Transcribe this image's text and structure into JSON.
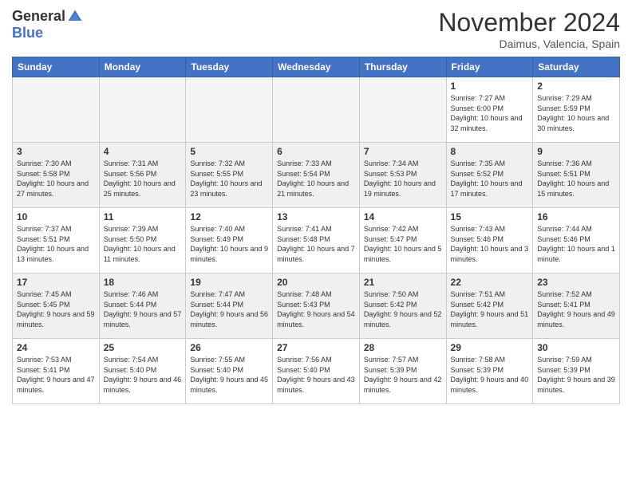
{
  "header": {
    "logo_general": "General",
    "logo_blue": "Blue",
    "month_title": "November 2024",
    "subtitle": "Daimus, Valencia, Spain"
  },
  "days_of_week": [
    "Sunday",
    "Monday",
    "Tuesday",
    "Wednesday",
    "Thursday",
    "Friday",
    "Saturday"
  ],
  "weeks": [
    [
      {
        "day": "",
        "info": "",
        "empty": true
      },
      {
        "day": "",
        "info": "",
        "empty": true
      },
      {
        "day": "",
        "info": "",
        "empty": true
      },
      {
        "day": "",
        "info": "",
        "empty": true
      },
      {
        "day": "",
        "info": "",
        "empty": true
      },
      {
        "day": "1",
        "info": "Sunrise: 7:27 AM\nSunset: 6:00 PM\nDaylight: 10 hours and 32 minutes."
      },
      {
        "day": "2",
        "info": "Sunrise: 7:29 AM\nSunset: 5:59 PM\nDaylight: 10 hours and 30 minutes."
      }
    ],
    [
      {
        "day": "3",
        "info": "Sunrise: 7:30 AM\nSunset: 5:58 PM\nDaylight: 10 hours and 27 minutes."
      },
      {
        "day": "4",
        "info": "Sunrise: 7:31 AM\nSunset: 5:56 PM\nDaylight: 10 hours and 25 minutes."
      },
      {
        "day": "5",
        "info": "Sunrise: 7:32 AM\nSunset: 5:55 PM\nDaylight: 10 hours and 23 minutes."
      },
      {
        "day": "6",
        "info": "Sunrise: 7:33 AM\nSunset: 5:54 PM\nDaylight: 10 hours and 21 minutes."
      },
      {
        "day": "7",
        "info": "Sunrise: 7:34 AM\nSunset: 5:53 PM\nDaylight: 10 hours and 19 minutes."
      },
      {
        "day": "8",
        "info": "Sunrise: 7:35 AM\nSunset: 5:52 PM\nDaylight: 10 hours and 17 minutes."
      },
      {
        "day": "9",
        "info": "Sunrise: 7:36 AM\nSunset: 5:51 PM\nDaylight: 10 hours and 15 minutes."
      }
    ],
    [
      {
        "day": "10",
        "info": "Sunrise: 7:37 AM\nSunset: 5:51 PM\nDaylight: 10 hours and 13 minutes."
      },
      {
        "day": "11",
        "info": "Sunrise: 7:39 AM\nSunset: 5:50 PM\nDaylight: 10 hours and 11 minutes."
      },
      {
        "day": "12",
        "info": "Sunrise: 7:40 AM\nSunset: 5:49 PM\nDaylight: 10 hours and 9 minutes."
      },
      {
        "day": "13",
        "info": "Sunrise: 7:41 AM\nSunset: 5:48 PM\nDaylight: 10 hours and 7 minutes."
      },
      {
        "day": "14",
        "info": "Sunrise: 7:42 AM\nSunset: 5:47 PM\nDaylight: 10 hours and 5 minutes."
      },
      {
        "day": "15",
        "info": "Sunrise: 7:43 AM\nSunset: 5:46 PM\nDaylight: 10 hours and 3 minutes."
      },
      {
        "day": "16",
        "info": "Sunrise: 7:44 AM\nSunset: 5:46 PM\nDaylight: 10 hours and 1 minute."
      }
    ],
    [
      {
        "day": "17",
        "info": "Sunrise: 7:45 AM\nSunset: 5:45 PM\nDaylight: 9 hours and 59 minutes."
      },
      {
        "day": "18",
        "info": "Sunrise: 7:46 AM\nSunset: 5:44 PM\nDaylight: 9 hours and 57 minutes."
      },
      {
        "day": "19",
        "info": "Sunrise: 7:47 AM\nSunset: 5:44 PM\nDaylight: 9 hours and 56 minutes."
      },
      {
        "day": "20",
        "info": "Sunrise: 7:48 AM\nSunset: 5:43 PM\nDaylight: 9 hours and 54 minutes."
      },
      {
        "day": "21",
        "info": "Sunrise: 7:50 AM\nSunset: 5:42 PM\nDaylight: 9 hours and 52 minutes."
      },
      {
        "day": "22",
        "info": "Sunrise: 7:51 AM\nSunset: 5:42 PM\nDaylight: 9 hours and 51 minutes."
      },
      {
        "day": "23",
        "info": "Sunrise: 7:52 AM\nSunset: 5:41 PM\nDaylight: 9 hours and 49 minutes."
      }
    ],
    [
      {
        "day": "24",
        "info": "Sunrise: 7:53 AM\nSunset: 5:41 PM\nDaylight: 9 hours and 47 minutes."
      },
      {
        "day": "25",
        "info": "Sunrise: 7:54 AM\nSunset: 5:40 PM\nDaylight: 9 hours and 46 minutes."
      },
      {
        "day": "26",
        "info": "Sunrise: 7:55 AM\nSunset: 5:40 PM\nDaylight: 9 hours and 45 minutes."
      },
      {
        "day": "27",
        "info": "Sunrise: 7:56 AM\nSunset: 5:40 PM\nDaylight: 9 hours and 43 minutes."
      },
      {
        "day": "28",
        "info": "Sunrise: 7:57 AM\nSunset: 5:39 PM\nDaylight: 9 hours and 42 minutes."
      },
      {
        "day": "29",
        "info": "Sunrise: 7:58 AM\nSunset: 5:39 PM\nDaylight: 9 hours and 40 minutes."
      },
      {
        "day": "30",
        "info": "Sunrise: 7:59 AM\nSunset: 5:39 PM\nDaylight: 9 hours and 39 minutes."
      }
    ]
  ]
}
